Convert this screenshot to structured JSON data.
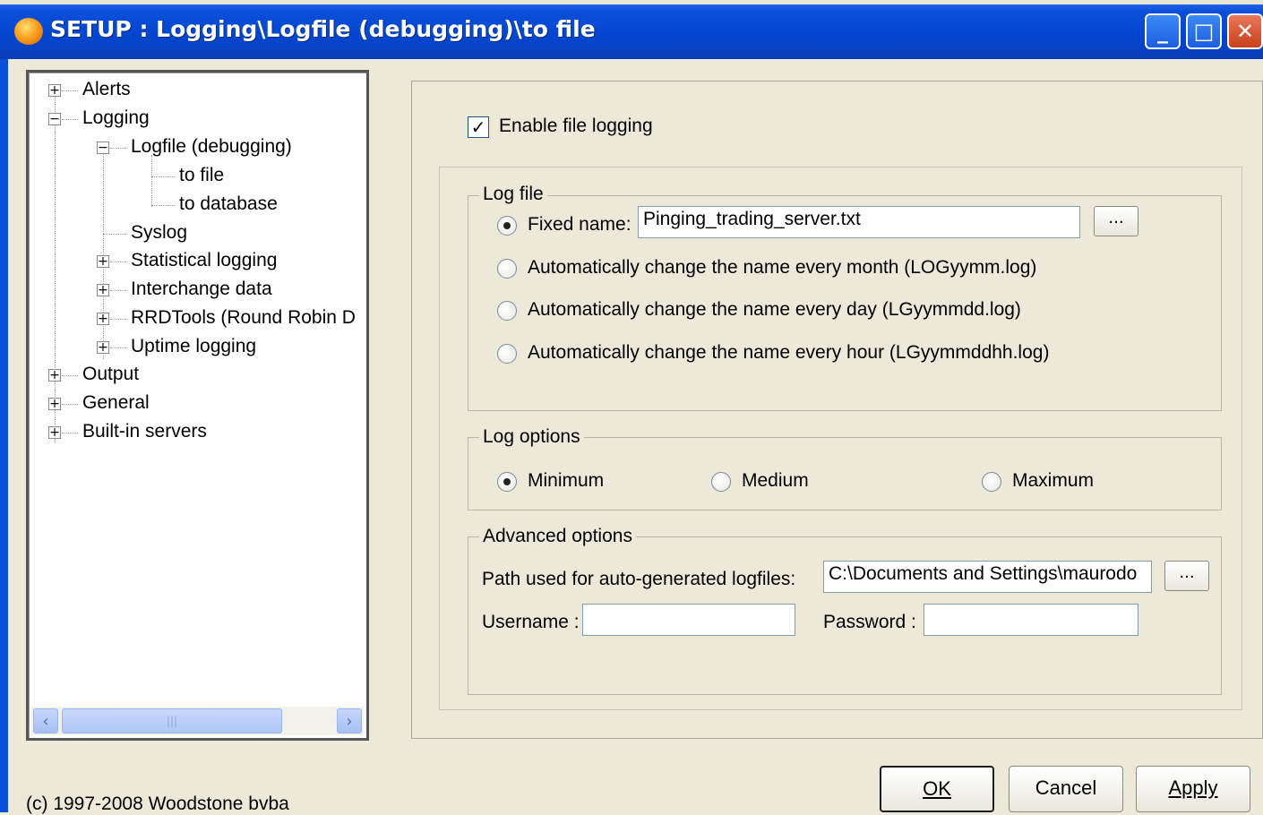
{
  "window": {
    "title": "SETUP : Logging\\Logfile (debugging)\\to file",
    "minimize_glyph": "_",
    "maximize_glyph": "□",
    "close_glyph": "✕"
  },
  "tree": {
    "items": [
      {
        "label": "Alerts",
        "expander": "+"
      },
      {
        "label": "Logging",
        "expander": "−"
      },
      {
        "label": "Logfile (debugging)",
        "expander": "−"
      },
      {
        "label": "to file"
      },
      {
        "label": "to database"
      },
      {
        "label": "Syslog"
      },
      {
        "label": "Statistical logging",
        "expander": "+"
      },
      {
        "label": "Interchange data",
        "expander": "+"
      },
      {
        "label": "RRDTools (Round Robin D",
        "expander": "+"
      },
      {
        "label": "Uptime logging",
        "expander": "+"
      },
      {
        "label": "Output",
        "expander": "+"
      },
      {
        "label": "General",
        "expander": "+"
      },
      {
        "label": "Built-in servers",
        "expander": "+"
      }
    ],
    "scroll_left": "‹",
    "scroll_right": "›",
    "thumb_grip": "|||"
  },
  "settings": {
    "enable_label": "Enable file logging",
    "enable_checked": true,
    "logfile": {
      "legend": "Log file",
      "fixed_label": "Fixed name:",
      "fixed_value": "Pinging_trading_server.txt",
      "browse": "...",
      "options": [
        "Automatically change the name every month (LOGyymm.log)",
        "Automatically change the name every day (LGyymmdd.log)",
        "Automatically change the name every hour (LGyymmddhh.log)"
      ],
      "selected": "Fixed name:"
    },
    "logoptions": {
      "legend": "Log options",
      "levels": [
        "Minimum",
        "Medium",
        "Maximum"
      ],
      "selected": "Minimum"
    },
    "advanced": {
      "legend": "Advanced options",
      "path_label": "Path used for auto-generated logfiles:",
      "path_value": "C:\\Documents and Settings\\maurodo",
      "browse": "...",
      "username_label": "Username :",
      "username_value": "",
      "password_label": "Password :",
      "password_value": ""
    }
  },
  "footer": {
    "copyright": "(c) 1997-2008 Woodstone bvba",
    "ok": "OK",
    "cancel": "Cancel",
    "apply": "Apply"
  }
}
